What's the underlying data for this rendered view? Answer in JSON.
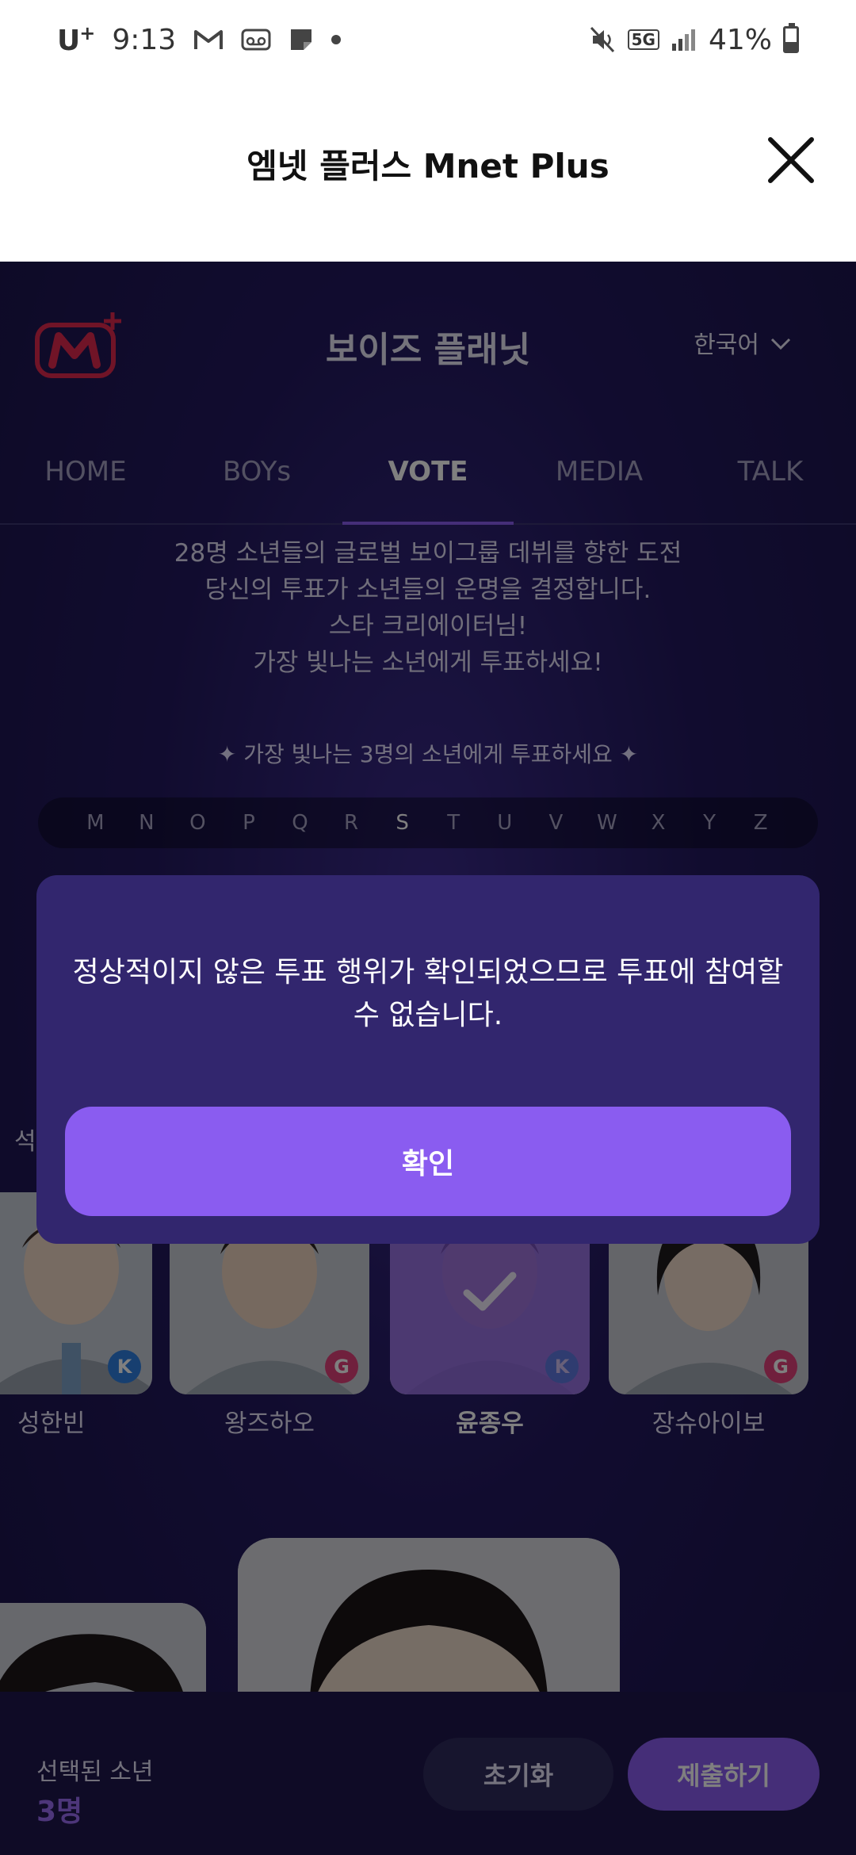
{
  "status_bar": {
    "carrier": "U",
    "carrier_suffix": "+",
    "time": "9:13",
    "network_badge": "5G",
    "battery_text": "41%",
    "battery_level": 0.41,
    "icons": [
      "gmail-icon",
      "voicemail-icon",
      "note-icon",
      "dot-icon",
      "mute-icon",
      "5g-icon",
      "signal-icon",
      "battery-icon"
    ]
  },
  "webview": {
    "title": "엠넷 플러스 Mnet Plus",
    "close_icon": "close-icon"
  },
  "header": {
    "site_title": "보이즈 플래닛",
    "language": "한국어"
  },
  "nav": {
    "tabs": [
      {
        "label": "HOME",
        "active": false
      },
      {
        "label": "BOYs",
        "active": false
      },
      {
        "label": "VOTE",
        "active": true
      },
      {
        "label": "MEDIA",
        "active": false
      },
      {
        "label": "TALK",
        "active": false
      }
    ]
  },
  "intro": {
    "line1": "28명 소년들의 글로벌 보이그룹 데뷔를 향한 도전",
    "line2": "당신의 투표가 소년들의 운명을 결정합니다.",
    "line3": "스타 크리에이터님!",
    "line4": "가장 빛나는 소년에게 투표하세요!"
  },
  "vote_prompt": "✦ 가장 빛나는 3명의 소년에게 투표하세요 ✦",
  "alphabet": {
    "letters": [
      "M",
      "N",
      "O",
      "P",
      "Q",
      "R",
      "S",
      "T",
      "U",
      "V",
      "W",
      "X",
      "Y",
      "Z"
    ],
    "active": "S"
  },
  "partial_name_left": "석",
  "cards": [
    {
      "name": "성한빈",
      "badge": "K",
      "badge_color": "#2f7fe0",
      "selected": false
    },
    {
      "name": "왕즈하오",
      "badge": "G",
      "badge_color": "#e0417a",
      "selected": false
    },
    {
      "name": "윤종우",
      "badge": "K",
      "badge_color": "#2f7fe0",
      "selected": true
    },
    {
      "name": "장슈아이보",
      "badge": "G",
      "badge_color": "#e0417a",
      "selected": false
    }
  ],
  "bottom_bar": {
    "selected_label": "선택된 소년",
    "selected_count": "3명",
    "reset_label": "초기화",
    "submit_label": "제출하기"
  },
  "modal": {
    "message": "정상적이지 않은 투표 행위가 확인되었으므로 투표에 참여할 수 없습니다.",
    "confirm_label": "확인"
  },
  "colors": {
    "accent": "#8a5cf0",
    "page_bg": "#23195f",
    "modal_bg": "#32266e",
    "logo_red": "#e0284f"
  }
}
